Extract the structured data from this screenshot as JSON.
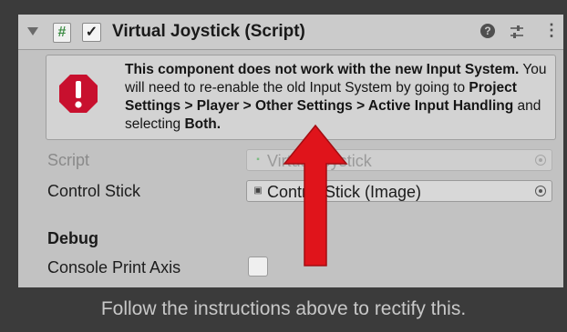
{
  "component": {
    "title": "Virtual Joystick (Script)",
    "script_glyph": "#",
    "enabled_glyph": "✓",
    "help_glyph": "?",
    "menu_glyph": "⋮"
  },
  "warning": {
    "part1": "This component does not work with the new Input System.",
    "part2": " You will need to re-enable the old Input System by going to ",
    "part3": "Project Settings > Player > Other Settings > Active Input Handling",
    "part4": " and selecting ",
    "part5": "Both."
  },
  "fields": {
    "script_label": "Script",
    "script_value": "VirtualJoystick",
    "control_label": "Control Stick",
    "control_value": "Control Stick (Image)"
  },
  "debug": {
    "section_label": "Debug",
    "print_label": "Console Print Axis",
    "print_checked": false
  },
  "caption": "Follow the instructions above to rectify this.",
  "colors": {
    "arrow": "#e0141b",
    "warning_icon": "#c8102e",
    "background": "#3b3b3b",
    "inspector": "#c2c2c2"
  }
}
